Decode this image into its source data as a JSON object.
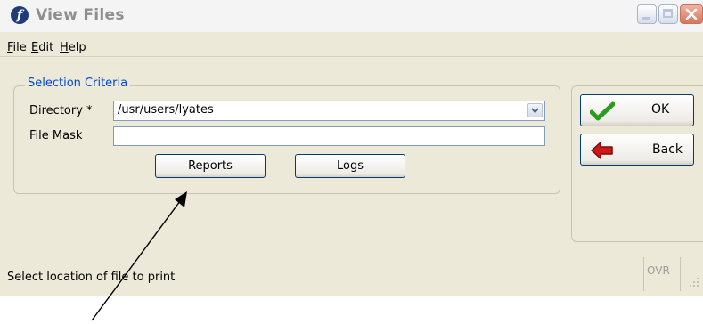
{
  "window": {
    "title": "View Files",
    "app_icon": "f-logo-icon"
  },
  "menu": {
    "items": [
      {
        "label": "File",
        "mnemonic": "F",
        "rest": "ile"
      },
      {
        "label": "Edit",
        "mnemonic": "E",
        "rest": "dit"
      },
      {
        "label": "Help",
        "mnemonic": "H",
        "rest": "elp"
      }
    ]
  },
  "selection_criteria": {
    "legend": "Selection Criteria",
    "directory": {
      "label": "Directory *",
      "value": "/usr/users/lyates"
    },
    "file_mask": {
      "label": "File Mask",
      "value": ""
    },
    "reports_button": "Reports",
    "logs_button": "Logs"
  },
  "side_buttons": {
    "ok": {
      "label": "OK",
      "icon": "check-icon"
    },
    "back": {
      "label": "Back",
      "icon": "back-arrow-icon"
    }
  },
  "status_bar": {
    "message": "Select location of file to print",
    "mode": "OVR"
  },
  "colors": {
    "window_bg": "#ece9d8",
    "legend_text": "#0046d5",
    "check_icon": "#2a9d1f",
    "back_icon": "#d01818"
  }
}
